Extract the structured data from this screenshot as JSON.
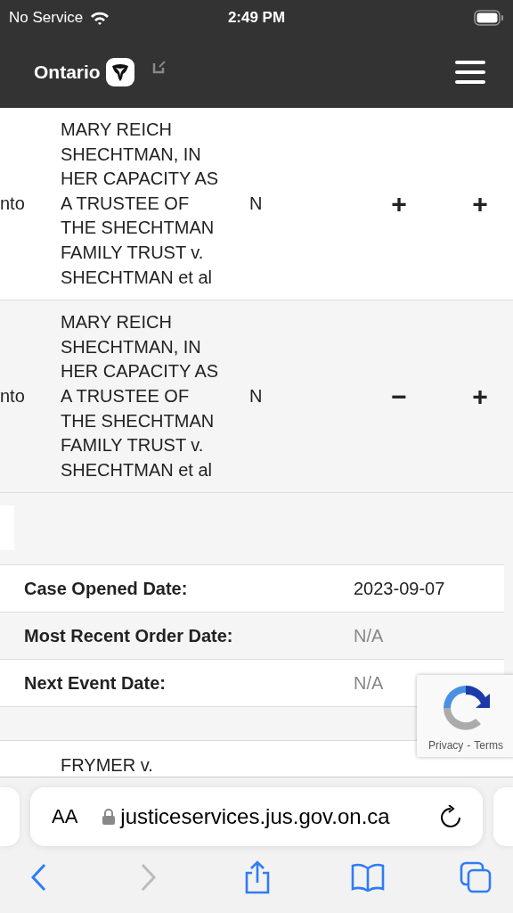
{
  "status_bar": {
    "carrier": "No Service",
    "time": "2:49 PM"
  },
  "header": {
    "brand": "Ontario"
  },
  "cases": [
    {
      "location": "nto",
      "title": "MARY REICH SHECHTMAN, IN HER CAPACITY AS A TRUSTEE OF THE SHECHTMAN FAMILY TRUST v. SHECHTMAN et al",
      "flag": "N",
      "toggle_1": "+",
      "toggle_2": "+"
    },
    {
      "location": "nto",
      "title": "MARY REICH SHECHTMAN, IN HER CAPACITY AS A TRUSTEE OF THE SHECHTMAN FAMILY TRUST v. SHECHTMAN et al",
      "flag": "N",
      "toggle_1": "−",
      "toggle_2": "+"
    }
  ],
  "details": [
    {
      "label": "Case Opened Date:",
      "value": "2023-09-07",
      "available": true
    },
    {
      "label": "Most Recent Order Date:",
      "value": "N/A",
      "available": false
    },
    {
      "label": "Next Event Date:",
      "value": "N/A",
      "available": false
    }
  ],
  "next_case": {
    "title": "FRYMER v."
  },
  "recaptcha": {
    "privacy": "Privacy",
    "separator": "-",
    "terms": "Terms"
  },
  "browser": {
    "text_size": "AA",
    "url": "justiceservices.jus.gov.on.ca",
    "forward_disabled": true
  }
}
